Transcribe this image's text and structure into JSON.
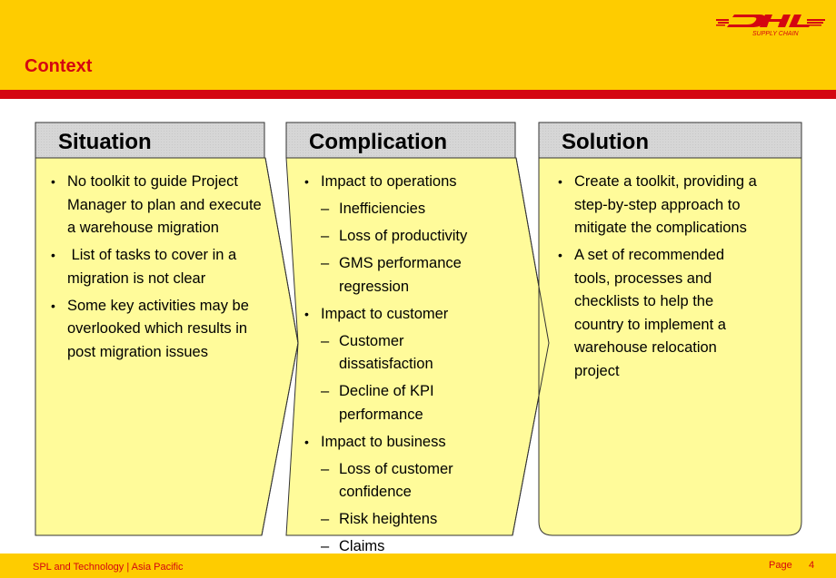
{
  "header": {
    "title": "Context",
    "logo": {
      "name": "DHL",
      "subtitle": "SUPPLY CHAIN"
    }
  },
  "colors": {
    "brand_yellow": "#fecc00",
    "brand_red": "#d40511",
    "box_fill": "#fffb9a",
    "header_fill": "#d9d9d9"
  },
  "columns": [
    {
      "title": "Situation",
      "items": [
        {
          "level": 1,
          "text": "No toolkit to guide Project Manager to plan and execute a warehouse migration"
        },
        {
          "level": 1,
          "text": " List of tasks to cover in a migration is not clear"
        },
        {
          "level": 1,
          "text": "Some key activities may be overlooked which results in post migration issues"
        }
      ]
    },
    {
      "title": "Complication",
      "items": [
        {
          "level": 1,
          "text": "Impact to operations"
        },
        {
          "level": 2,
          "text": "Inefficiencies"
        },
        {
          "level": 2,
          "text": "Loss of productivity"
        },
        {
          "level": 2,
          "text": "GMS performance regression"
        },
        {
          "level": 1,
          "text": "Impact to customer"
        },
        {
          "level": 2,
          "text": "Customer dissatisfaction"
        },
        {
          "level": 2,
          "text": "Decline of KPI performance"
        },
        {
          "level": 1,
          "text": "Impact to business"
        },
        {
          "level": 2,
          "text": "Loss of customer confidence"
        },
        {
          "level": 2,
          "text": "Risk heightens"
        },
        {
          "level": 2,
          "text": "Claims"
        }
      ]
    },
    {
      "title": "Solution",
      "items": [
        {
          "level": 1,
          "text": "Create a toolkit, providing a step-by-step approach to mitigate the complications"
        },
        {
          "level": 1,
          "text": "A set of recommended tools, processes and checklists to help the country to implement a warehouse relocation project"
        }
      ]
    }
  ],
  "footer": {
    "left_text": "SPL and Technology | Asia Pacific",
    "page_label": "Page",
    "page_number": "4"
  }
}
